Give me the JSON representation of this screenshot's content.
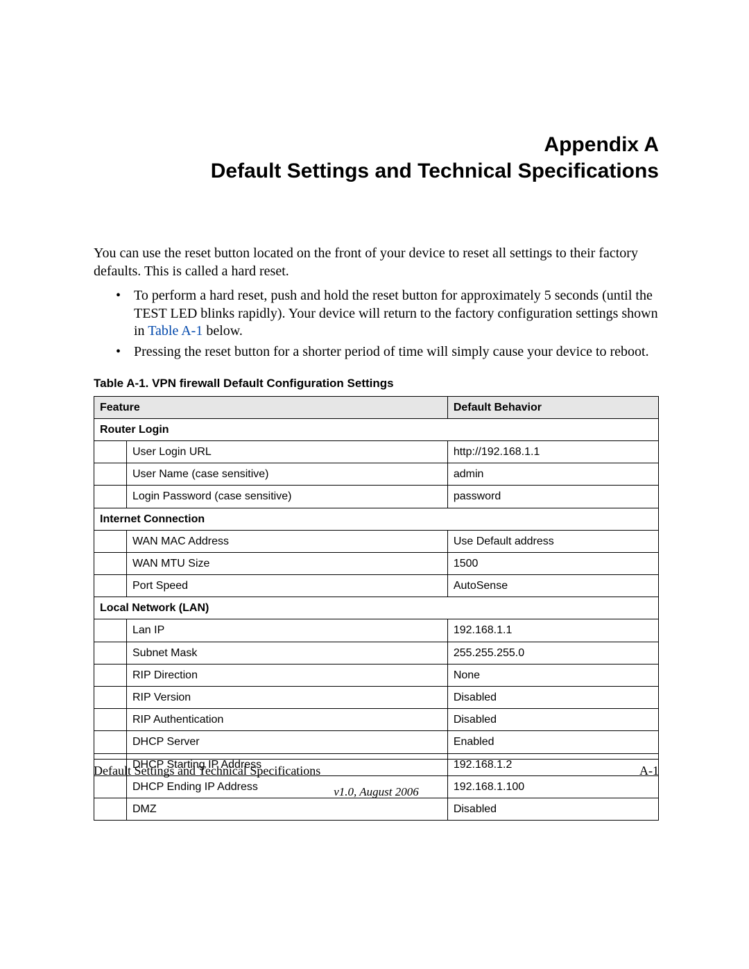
{
  "title": {
    "line1": "Appendix A",
    "line2": "Default Settings and Technical Specifications"
  },
  "intro": "You can use the reset button located on the front of your device to reset all settings to their factory defaults. This is called a hard reset.",
  "bullets": [
    {
      "pre": "To perform a hard reset, push and hold the reset button for approximately 5 seconds (until the TEST LED blinks rapidly). Your device will return to the factory configuration settings shown in ",
      "link": "Table A-1",
      "post": " below."
    },
    {
      "pre": "Pressing the reset button for a shorter period of time will simply cause your device to reboot.",
      "link": "",
      "post": ""
    }
  ],
  "table": {
    "caption": "Table A-1.  VPN firewall Default Configuration Settings",
    "headers": {
      "feature": "Feature",
      "behavior": "Default Behavior"
    },
    "sections": [
      {
        "name": "Router Login",
        "rows": [
          {
            "feature": "User Login URL",
            "value": "http://192.168.1.1"
          },
          {
            "feature": "User Name (case sensitive)",
            "value": "admin"
          },
          {
            "feature": "Login Password (case sensitive)",
            "value": "password"
          }
        ]
      },
      {
        "name": "Internet Connection",
        "rows": [
          {
            "feature": "WAN MAC Address",
            "value": "Use Default address"
          },
          {
            "feature": "WAN MTU Size",
            "value": "1500"
          },
          {
            "feature": "Port Speed",
            "value": "AutoSense"
          }
        ]
      },
      {
        "name": "Local Network (LAN)",
        "rows": [
          {
            "feature": "Lan IP",
            "value": "192.168.1.1"
          },
          {
            "feature": "Subnet Mask",
            "value": "255.255.255.0"
          },
          {
            "feature": "RIP Direction",
            "value": "None"
          },
          {
            "feature": "RIP Version",
            "value": "Disabled"
          },
          {
            "feature": "RIP Authentication",
            "value": "Disabled"
          },
          {
            "feature": "DHCP Server",
            "value": "Enabled"
          },
          {
            "feature": "DHCP Starting IP Address",
            "value": "192.168.1.2"
          },
          {
            "feature": "DHCP Ending IP Address",
            "value": "192.168.1.100"
          },
          {
            "feature": "DMZ",
            "value": "Disabled"
          }
        ]
      }
    ]
  },
  "footer": {
    "left": "Default Settings and Technical Specifications",
    "right": "A-1",
    "version": "v1.0, August 2006"
  }
}
